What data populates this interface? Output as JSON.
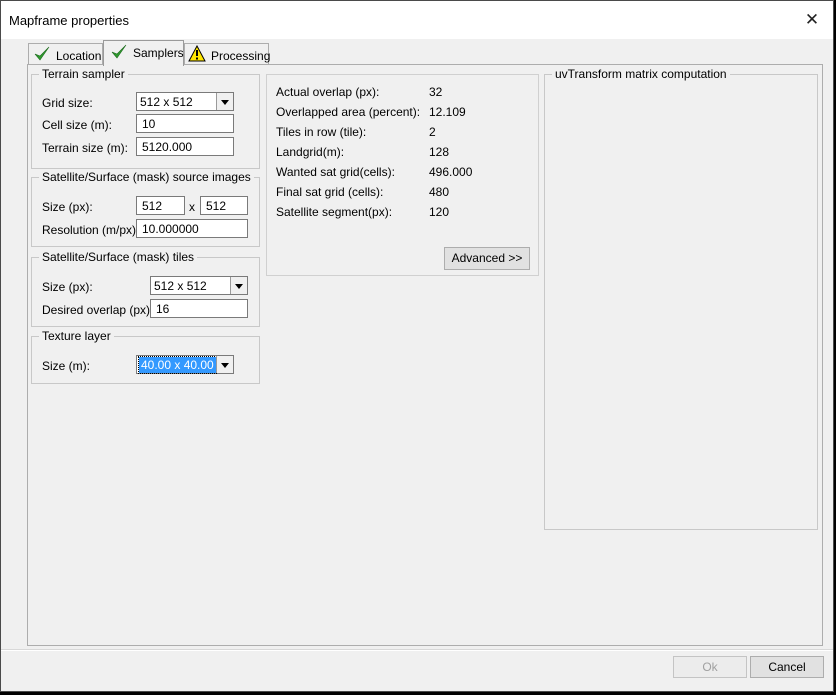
{
  "window": {
    "title": "Mapframe properties",
    "close_label": "✕"
  },
  "tabs": [
    {
      "label": "Location",
      "icon": "check-icon"
    },
    {
      "label": "Samplers",
      "icon": "check-icon"
    },
    {
      "label": "Processing",
      "icon": "warning-icon"
    }
  ],
  "terrain": {
    "title": "Terrain sampler",
    "grid_label": "Grid size:",
    "grid_value": "512 x 512",
    "cell_label": "Cell size (m):",
    "cell_value": "10",
    "terrain_label": "Terrain size (m):",
    "terrain_value": "5120.000"
  },
  "sat_images": {
    "title": "Satellite/Surface (mask) source images",
    "size_label": "Size (px):",
    "width": "512",
    "x_sep": "x",
    "height": "512",
    "res_label": "Resolution (m/px):",
    "res_value": "10.000000"
  },
  "sat_tiles": {
    "title": "Satellite/Surface (mask) tiles",
    "size_label": "Size (px):",
    "size_value": "512 x 512",
    "overlap_label": "Desired overlap (px):",
    "overlap_value": "16"
  },
  "texture": {
    "title": "Texture layer",
    "size_label": "Size (m):",
    "size_value": "40.00 x 40.00"
  },
  "stats": [
    {
      "label": "Actual overlap (px):",
      "value": "32"
    },
    {
      "label": "Overlapped area (percent):",
      "value": "12.109"
    },
    {
      "label": "Tiles in row (tile):",
      "value": "2"
    },
    {
      "label": "Landgrid(m):",
      "value": "128"
    },
    {
      "label": "Wanted sat grid(cells):",
      "value": "496.000"
    },
    {
      "label": "Final sat grid (cells):",
      "value": "480"
    },
    {
      "label": "Satellite segment(px):",
      "value": "120"
    }
  ],
  "advanced_label": "Advanced >>",
  "uv": {
    "title": "uvTransform matrix computation"
  },
  "footer": {
    "ok_label": "Ok",
    "cancel_label": "Cancel"
  },
  "colors": {
    "check": "#2e9a2e",
    "warning_fill": "#ffe600",
    "selection": "#3399ff"
  }
}
